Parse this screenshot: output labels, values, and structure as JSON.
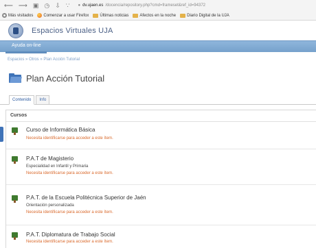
{
  "browser": {
    "nav_icons": [
      "back-icon",
      "forward-icon",
      "home-icon",
      "history-icon",
      "download-icon",
      "rss-icon"
    ],
    "url_host": "dv.ujaen.es",
    "url_path": "/docencia/repository.php?cmd=frameset&ref_id=94372"
  },
  "bookmarks": [
    {
      "label": "Más visitados",
      "icon": "gear-icon"
    },
    {
      "label": "Comenzar a usar Firefox",
      "icon": "firefox-icon"
    },
    {
      "label": "Últimas noticias",
      "icon": "folder-icon"
    },
    {
      "label": "Afectos en la noche",
      "icon": "folder-icon"
    },
    {
      "label": "Diario Digital de la UJA",
      "icon": "folder-icon"
    }
  ],
  "header": {
    "site_title": "Espacios Virtuales UJA"
  },
  "menu": {
    "item": "Ayuda on-line"
  },
  "breadcrumb": "Espacios » Otros » Plan Acción Tutorial",
  "page": {
    "title": "Plan Acción Tutorial"
  },
  "tabs": [
    {
      "label": "Contenido",
      "active": true
    },
    {
      "label": "Info",
      "active": false
    }
  ],
  "section": {
    "title": "Cursos",
    "items": [
      {
        "title": "Curso de Informática Básica",
        "subtitle": "",
        "note": "Necesita identificarse para acceder a este ítem."
      },
      {
        "title": "P.A.T de Magisterio",
        "subtitle": "Especialidad en Infantil y Primaria",
        "note": "Necesita identificarse para acceder a este ítem."
      },
      {
        "title": "P.A.T. de la Escuela Politécnica Superior de Jaén",
        "subtitle": "Orientación personalizada",
        "note": "Necesita identificarse para acceder a este ítem."
      },
      {
        "title": "P.A.T. Diplomatura de Trabajo Social",
        "subtitle": "",
        "note": "Necesita identificarse para acceder a este ítem."
      }
    ]
  },
  "colors": {
    "accent": "#7fa6d2",
    "link": "#3d67a8",
    "warning": "#d9682a"
  }
}
